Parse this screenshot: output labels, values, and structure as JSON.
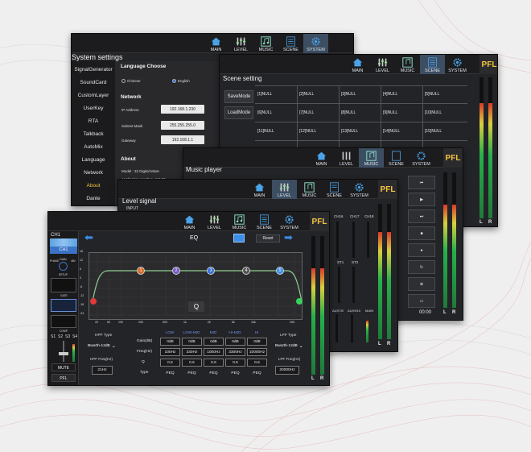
{
  "nav": {
    "main": "MAIN",
    "level": "LEVEL",
    "music": "MUSIC",
    "scene": "SCENE",
    "system": "SYSTEM"
  },
  "pfl": "PFL",
  "meter": {
    "left": "L",
    "right": "R",
    "clip": "CLIP"
  },
  "system": {
    "title": "System settings",
    "menu": [
      "SignalGenerator",
      "SoundCard",
      "CustomLayer",
      "UserKey",
      "RTA",
      "Talkback",
      "AutoMix",
      "Language",
      "Network",
      "About",
      "Dante"
    ],
    "active_menu": "About",
    "language_title": "Language Choose",
    "lang_chinese": "Chinese",
    "lang_english": "English",
    "network_title": "Network",
    "ip_label": "IP Address",
    "ip_value": "192.168.1.230",
    "mask_label": "Subnet Mask",
    "mask_value": "255.255.255.0",
    "gateway_label": "Gateway",
    "gateway_value": "192.168.1.1",
    "about_title": "About",
    "model": "Model : 32 Digital Mixer",
    "app_number": "Application number : 3.3.26"
  },
  "scene": {
    "title": "Scene setting",
    "save_mode": "SaveMode",
    "load_mode": "LoadMode",
    "cells": [
      "[1]NULL",
      "[2]NULL",
      "[3]NULL",
      "[4]NULL",
      "[5]NULL",
      "[6]NULL",
      "[7]NULL",
      "[8]NULL",
      "[9]NULL",
      "[10]NULL",
      "[11]NULL",
      "[12]NULL",
      "[13]NULL",
      "[14]NULL",
      "[15]NULL"
    ]
  },
  "music": {
    "title": "Music player",
    "time": "00:00"
  },
  "level": {
    "title": "Level signal",
    "input": "INPUT",
    "ch_labels": [
      "CH15",
      "CH16",
      "CH17",
      "CH18"
    ],
    "st_labels": [
      "ST1",
      "ST2"
    ],
    "aux_labels": [
      "AUX7/8",
      "AUX9/10",
      "MAIN"
    ]
  },
  "eq": {
    "channel_top": "CH1",
    "channel_name": "CH1",
    "title": "EQ",
    "reset": "Reset",
    "q_label": "Q",
    "x_ticks": [
      "20",
      "50",
      "100",
      "200",
      "500",
      "1k",
      "2k",
      "5k",
      "10k",
      "20K"
    ],
    "y_ticks": [
      "18",
      "12",
      "6",
      "0",
      "-6",
      "-12",
      "-18",
      "-24"
    ],
    "nodes": [
      "1",
      "2",
      "3",
      "4",
      "5"
    ],
    "hpf_type_label": "HPF Type",
    "hpf_type": "Bworth-12dB",
    "hpf_freq_label": "HPF Freq(Hz)",
    "hpf_freq": "21Hz",
    "lpf_type_label": "LPF Type",
    "lpf_type": "Bworth-12dB",
    "lpf_freq_label": "LPF Freq(Hz)",
    "lpf_freq": "20000Hz",
    "band_headers": [
      "LOW",
      "LOW-MID",
      "MID",
      "HI-MID",
      "HI"
    ],
    "row_labels": [
      "Gain(dB)",
      "Freq(Hz)",
      "Q",
      "Type"
    ],
    "gain": [
      "0dB",
      "0dB",
      "0dB",
      "0dB",
      "0dB"
    ],
    "freq": [
      "100Hz",
      "330Hz",
      "1000Hz",
      "3300Hz",
      "10000Hz"
    ],
    "q": [
      "0.6",
      "0.6",
      "0.6",
      "0.6",
      "0.6"
    ],
    "type": [
      "PEQ",
      "PEQ",
      "PEQ",
      "PEQ",
      "PEQ"
    ],
    "strip_labels": [
      "S1",
      "S2",
      "S3",
      "S4"
    ],
    "mute": "MUTE",
    "pfl_btn": "PFL",
    "small_labels": [
      "GAIN",
      "PHASE",
      "48V",
      "SETUP",
      "GATE",
      "COMP"
    ]
  },
  "colors": {
    "accent": "#3a6fd8",
    "nav_active": "#3d4e63",
    "pfl": "#f3c43e",
    "mute": "#c7342a",
    "line": "#8fd08f"
  }
}
